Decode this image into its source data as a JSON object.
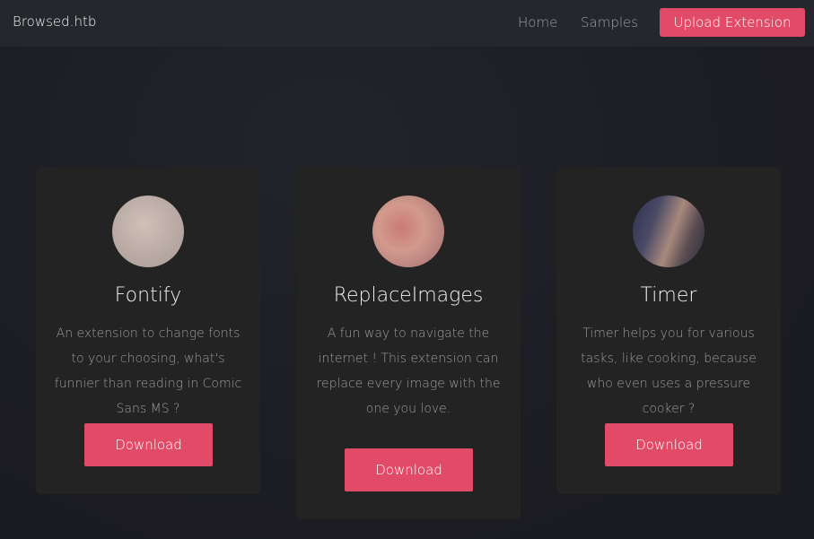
{
  "navbar": {
    "brand": "Browsed.htb",
    "links": [
      "Home",
      "Samples"
    ],
    "upload_label": "Upload Extension"
  },
  "extensions": [
    {
      "title": "Fontify",
      "description": "An extension to change fonts to your choosing, what's funnier than reading in Comic Sans MS ?",
      "button": "Download"
    },
    {
      "title": "ReplaceImages",
      "description": "A fun way to navigate the internet ! This extension can replace every image with the one you love.",
      "button": "Download"
    },
    {
      "title": "Timer",
      "description": "Timer helps you for various tasks, like cooking, because who even uses a pressure cooker ?",
      "button": "Download"
    }
  ],
  "colors": {
    "accent": "#e24b68",
    "background": "#1c1d23",
    "navbar": "#25272d",
    "card": "#232323"
  }
}
